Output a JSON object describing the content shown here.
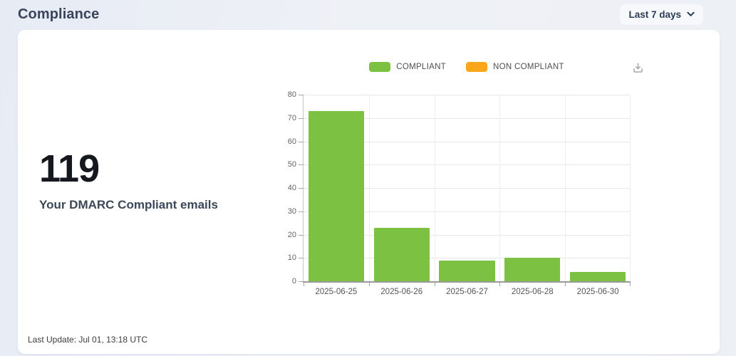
{
  "header": {
    "title": "Compliance",
    "range_selector": {
      "value": "Last 7 days"
    }
  },
  "icons": {
    "chevron_down_icon": "v-shaped chevron pointing down",
    "download_icon": "down arrow into tray"
  },
  "colors": {
    "compliant_green": "#7dc142",
    "non_compliant_orange": "#faa61a",
    "page_background": "#edf0f6",
    "card_background": "#ffffff"
  },
  "stat": {
    "value": "119",
    "label": "Your DMARC Compliant emails"
  },
  "chart_data": {
    "type": "bar",
    "title": "",
    "categories": [
      "2025-06-25",
      "2025-06-26",
      "2025-06-27",
      "2025-06-28",
      "2025-06-30"
    ],
    "series": [
      {
        "name": "COMPLIANT",
        "color": "#7dc142",
        "values": [
          73,
          23,
          9,
          10,
          4
        ]
      },
      {
        "name": "NON COMPLIANT",
        "color": "#faa61a",
        "values": [
          0,
          0,
          0,
          0,
          0
        ]
      }
    ],
    "xlabel": "",
    "ylabel": "",
    "ylim": [
      0,
      80
    ],
    "yticks": [
      0,
      10,
      20,
      30,
      40,
      50,
      60,
      70,
      80
    ],
    "grid": true,
    "legend_position": "top"
  },
  "footer": {
    "last_update": "Last Update: Jul 01, 13:18 UTC"
  }
}
